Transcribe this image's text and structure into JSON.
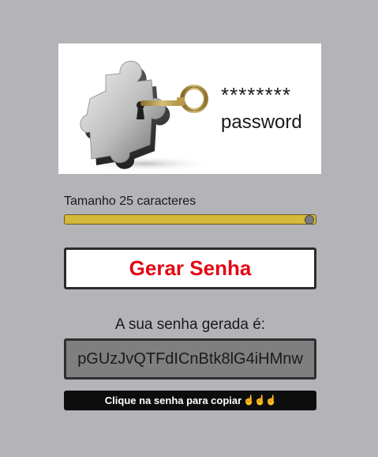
{
  "hero": {
    "stars": "********",
    "word": "password",
    "image": "puzzle-piece-with-key"
  },
  "length": {
    "label": "Tamanho 25 caracteres",
    "value": 25,
    "fill_fraction": 1.0
  },
  "generate": {
    "label": "Gerar Senha"
  },
  "result": {
    "label": "A sua senha gerada é:",
    "password": "pGUzJvQTFdICnBtk8lG4iHMnw"
  },
  "copy_hint": {
    "label": "Clique na senha para copiar",
    "icons": [
      "pointing-hand-icon",
      "pointing-hand-icon",
      "pointing-hand-icon"
    ]
  },
  "colors": {
    "background": "#b3b3b8",
    "slider_accent": "#d4b93a",
    "button_text": "#e30613",
    "password_box": "#7f7f7f",
    "hint_bar": "#0d0d0d"
  }
}
